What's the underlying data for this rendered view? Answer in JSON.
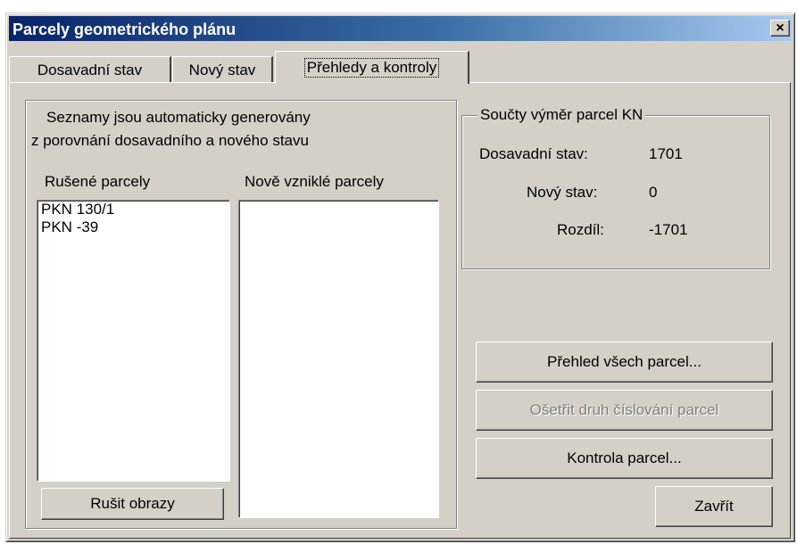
{
  "window": {
    "title": "Parcely geometrického plánu",
    "close_glyph": "×"
  },
  "tabs": [
    {
      "label": "Dosavadní stav"
    },
    {
      "label": "Nový stav"
    },
    {
      "label": "Přehledy a kontroly"
    }
  ],
  "left_panel": {
    "info_line1": "Seznamy jsou automaticky generovány",
    "info_line2": "z porovnání dosavadního a nového stavu",
    "cancelled_label": "Rušené parcely",
    "new_label": "Nově vzniklé parcely",
    "cancelled_items": [
      "PKN 130/1",
      "PKN -39"
    ],
    "new_items": [],
    "cancel_images_button": "Rušit obrazy"
  },
  "sums": {
    "title": "Součty výměr parcel KN",
    "rows": [
      {
        "label": "Dosavadní stav:",
        "value": "1701"
      },
      {
        "label": "Nový stav:",
        "value": "0"
      },
      {
        "label": "Rozdíl:",
        "value": "-1701"
      }
    ]
  },
  "buttons": {
    "overview": "Přehled všech parcel...",
    "numbering": "Ošetřit druh číslování parcel",
    "check": "Kontrola parcel...",
    "close": "Zavřít"
  }
}
